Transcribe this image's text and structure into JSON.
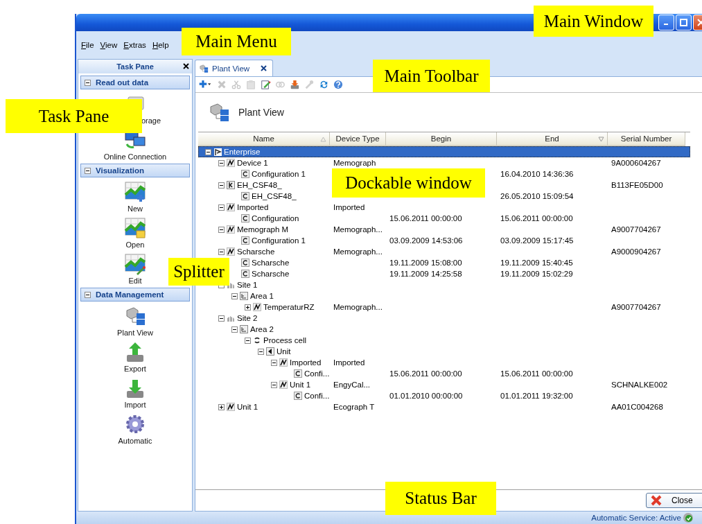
{
  "menu": [
    {
      "label": "File"
    },
    {
      "label": "View"
    },
    {
      "label": "Extras"
    },
    {
      "label": "Help"
    }
  ],
  "task_pane": {
    "title": "Task Pane",
    "sections": [
      {
        "title": "Read out data",
        "expanded": true,
        "items": [
          {
            "label": "orage",
            "kind": "storage"
          },
          {
            "label": "Online Connection",
            "kind": "online"
          }
        ]
      },
      {
        "title": "Visualization",
        "expanded": true,
        "items": [
          {
            "label": "New",
            "kind": "chart-new"
          },
          {
            "label": "Open",
            "kind": "chart-open"
          },
          {
            "label": "Edit",
            "kind": "chart-edit"
          }
        ]
      },
      {
        "title": "Data Management",
        "expanded": true,
        "items": [
          {
            "label": "Plant View",
            "kind": "plant"
          },
          {
            "label": "Export",
            "kind": "export"
          },
          {
            "label": "Import",
            "kind": "import"
          },
          {
            "label": "Automatic",
            "kind": "gear"
          }
        ]
      }
    ]
  },
  "tabs": [
    {
      "label": "Plant View",
      "selected": true
    }
  ],
  "toolbar": [
    {
      "kind": "add",
      "disabled": false
    },
    {
      "kind": "delete",
      "disabled": true
    },
    {
      "kind": "cut",
      "disabled": true
    },
    {
      "kind": "paste",
      "disabled": true
    },
    {
      "kind": "edit",
      "disabled": false
    },
    {
      "kind": "link",
      "disabled": true
    },
    {
      "kind": "import",
      "disabled": false
    },
    {
      "kind": "wrench",
      "disabled": true
    },
    {
      "kind": "refresh",
      "disabled": false
    },
    {
      "kind": "help",
      "disabled": false
    }
  ],
  "view_title": "Plant View",
  "table": {
    "columns": [
      {
        "label": "Name",
        "sorted": true
      },
      {
        "label": "Device Type"
      },
      {
        "label": "Begin"
      },
      {
        "label": "End",
        "filtered": true
      },
      {
        "label": "Serial Number"
      }
    ],
    "tree": [
      {
        "name": "Enterprise",
        "kind": "enterprise",
        "expanded": true,
        "selected": true,
        "children": [
          {
            "name": "Device 1",
            "kind": "device",
            "expanded": true,
            "selected": false,
            "device_type": "Memograph",
            "serial": "9A000604267",
            "children": [
              {
                "name": "Configuration 1",
                "kind": "config",
                "selected": false,
                "end": "16.04.2010 14:36:36"
              }
            ]
          },
          {
            "name": "EH_CSF48_",
            "kind": "recorder",
            "expanded": true,
            "selected": false,
            "serial": "B113FE05D00",
            "children": [
              {
                "name": "EH_CSF48_",
                "kind": "config",
                "selected": false,
                "end": "26.05.2010 15:09:54"
              }
            ]
          },
          {
            "name": "Imported",
            "kind": "device",
            "expanded": true,
            "selected": false,
            "device_type": "Imported",
            "children": [
              {
                "name": "Configuration",
                "kind": "config",
                "selected": false,
                "begin": "15.06.2011 00:00:00",
                "end": "15.06.2011 00:00:00"
              }
            ]
          },
          {
            "name": "Memograph M",
            "kind": "device",
            "expanded": true,
            "selected": false,
            "device_type": "Memograph...",
            "serial": "A9007704267",
            "children": [
              {
                "name": "Configuration 1",
                "kind": "config",
                "selected": false,
                "begin": "03.09.2009 14:53:06",
                "end": "03.09.2009 15:17:45"
              }
            ]
          },
          {
            "name": "Scharsche",
            "kind": "device",
            "expanded": true,
            "selected": false,
            "device_type": "Memograph...",
            "serial": "A9000904267",
            "children": [
              {
                "name": "Scharsche",
                "kind": "config",
                "selected": false,
                "begin": "19.11.2009 15:08:00",
                "end": "19.11.2009 15:40:45"
              },
              {
                "name": "Scharsche",
                "kind": "config",
                "selected": false,
                "begin": "19.11.2009 14:25:58",
                "end": "19.11.2009 15:02:29"
              }
            ]
          },
          {
            "name": "Site 1",
            "kind": "site",
            "expanded": true,
            "selected": false,
            "children": [
              {
                "name": "Area 1",
                "kind": "area",
                "expanded": true,
                "selected": false,
                "children": [
                  {
                    "name": "TemperaturRZ",
                    "kind": "device",
                    "expanded": false,
                    "selected": false,
                    "device_type": "Memograph...",
                    "serial": "A9007704267"
                  }
                ]
              }
            ]
          },
          {
            "name": "Site 2",
            "kind": "site",
            "expanded": true,
            "selected": false,
            "children": [
              {
                "name": "Area 2",
                "kind": "area",
                "expanded": true,
                "selected": false,
                "children": [
                  {
                    "name": "Process cell",
                    "kind": "cell",
                    "expanded": true,
                    "selected": false,
                    "children": [
                      {
                        "name": "Unit",
                        "kind": "unit",
                        "expanded": true,
                        "selected": false,
                        "children": [
                          {
                            "name": "Imported",
                            "kind": "device",
                            "expanded": true,
                            "selected": false,
                            "device_type": "Imported",
                            "children": [
                              {
                                "name": "Confi...",
                                "kind": "config",
                                "selected": false,
                                "begin": "15.06.2011 00:00:00",
                                "end": "15.06.2011 00:00:00"
                              }
                            ]
                          },
                          {
                            "name": "Unit 1",
                            "kind": "device",
                            "expanded": true,
                            "selected": false,
                            "device_type": "EngyCal...",
                            "serial": "SCHNALKE002",
                            "children": [
                              {
                                "name": "Confi...",
                                "kind": "config",
                                "selected": false,
                                "begin": "01.01.2010 00:00:00",
                                "end": "01.01.2011 19:32:00"
                              }
                            ]
                          }
                        ]
                      }
                    ]
                  }
                ]
              }
            ]
          },
          {
            "name": "Unit 1",
            "kind": "device",
            "expanded": false,
            "selected": false,
            "device_type": "Ecograph T",
            "serial": "AA01C004268"
          }
        ]
      }
    ]
  },
  "close_button": "Close",
  "status_bar": {
    "text": "Automatic Service: Active"
  },
  "annotations": [
    {
      "text": "Main Window"
    },
    {
      "text": "Main Menu"
    },
    {
      "text": "Main Toolbar"
    },
    {
      "text": "Task Pane"
    },
    {
      "text": "Dockable window"
    },
    {
      "text": "Splitter"
    },
    {
      "text": "Status Bar"
    }
  ]
}
